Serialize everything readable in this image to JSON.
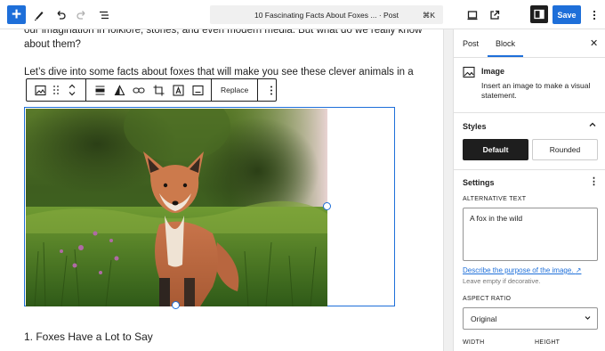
{
  "toolbar": {
    "add_label": "+",
    "command_title": "10 Fascinating Facts About Foxes ... · Post",
    "shortcut": "⌘K",
    "save_label": "Save"
  },
  "editor": {
    "top_paragraph_line1": "our imagination in folklore, stories, and even modern media. But what do we really know",
    "top_paragraph_line2": "about them?",
    "intro_paragraph": "Let’s dive into some facts about foxes that will make you see these clever animals in a",
    "replace_label": "Replace",
    "heading_1": "1. Foxes Have a Lot to Say"
  },
  "sidebar": {
    "tab_post": "Post",
    "tab_block": "Block",
    "block_name": "Image",
    "block_description": "Insert an image to make a visual statement.",
    "styles_title": "Styles",
    "style_default": "Default",
    "style_rounded": "Rounded",
    "settings_title": "Settings",
    "alt_text_label": "ALTERNATIVE TEXT",
    "alt_text_value": "A fox in the wild",
    "alt_link": "Describe the purpose of the image.",
    "alt_help": "Leave empty if decorative.",
    "aspect_ratio_label": "ASPECT RATIO",
    "aspect_ratio_value": "Original",
    "width_label": "WIDTH",
    "height_label": "HEIGHT"
  },
  "colors": {
    "accent": "#1e6fd9",
    "dark": "#1e1e1e"
  }
}
